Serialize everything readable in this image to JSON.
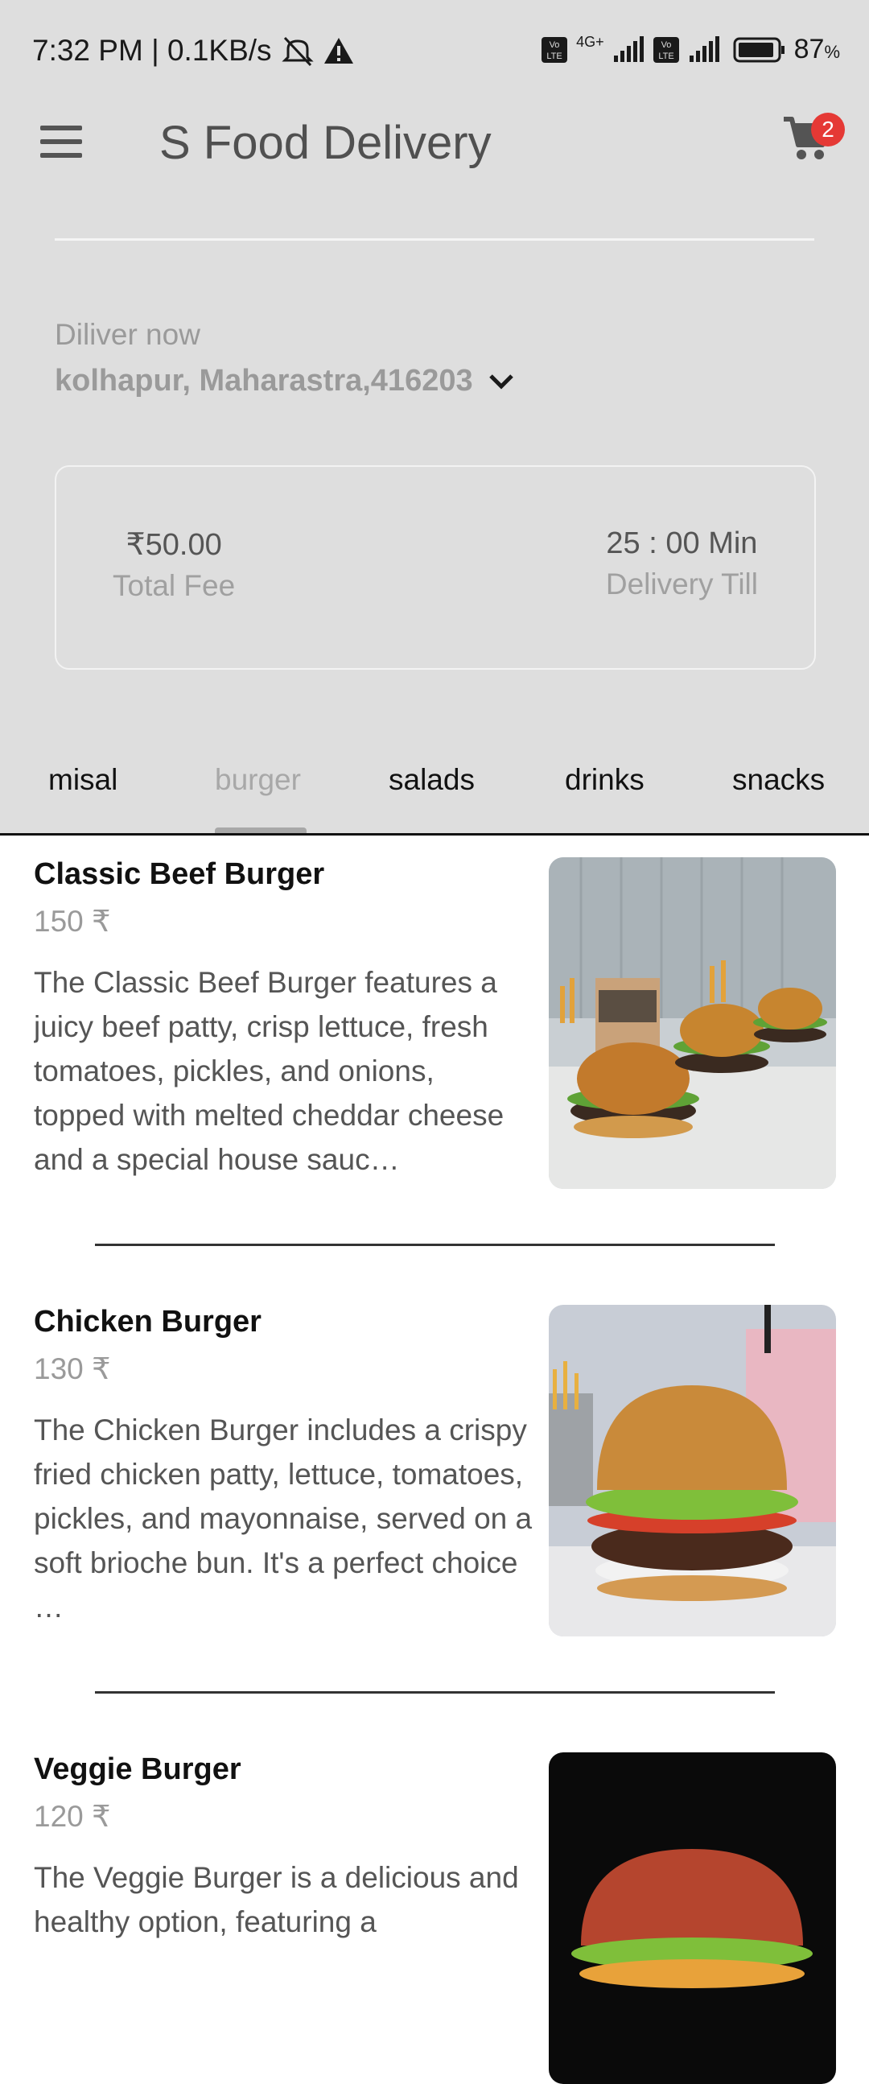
{
  "status_bar": {
    "time_speed": "7:32 PM | 0.1KB/s",
    "network": "4G+",
    "battery": "87",
    "battery_unit": "%"
  },
  "app": {
    "title": "S Food Delivery",
    "cart_count": "2"
  },
  "delivery": {
    "label": "Diliver now",
    "address": "kolhapur, Maharastra,416203"
  },
  "summary": {
    "fee_value": "₹50.00",
    "fee_label": "Total Fee",
    "time_value": "25 : 00 Min",
    "time_label": "Delivery Till"
  },
  "tabs": [
    "misal",
    "burger",
    "salads",
    "drinks",
    "snacks"
  ],
  "active_tab": "burger",
  "items": [
    {
      "name": "Classic Beef Burger",
      "price": "150 ₹",
      "description": "The Classic Beef Burger features a juicy beef patty, crisp lettuce, fresh tomatoes, pickles, and onions, topped with melted cheddar cheese and a special house sauc…"
    },
    {
      "name": "Chicken Burger",
      "price": "130 ₹",
      "description": "The Chicken Burger includes a crispy fried chicken patty, lettuce, tomatoes, pickles, and mayonnaise, served on a soft brioche bun. It's a perfect choice …"
    },
    {
      "name": "Veggie Burger",
      "price": "120 ₹",
      "description": "The Veggie Burger is a delicious and healthy option, featuring a"
    }
  ],
  "colors": {
    "header_bg": "#dedede",
    "badge": "#e53935",
    "active_tab": "#a8a8a8"
  }
}
